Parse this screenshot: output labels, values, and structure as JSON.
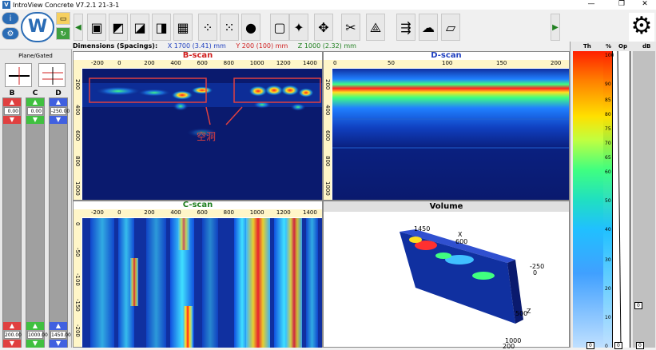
{
  "app": {
    "title": "IntroView Concrete V7.2.1   21-3-1",
    "icon": "V",
    "min": "—",
    "max": "❐",
    "close": "✕"
  },
  "toolbar": {
    "icons": [
      "cube-icon",
      "cube-red-icon",
      "cube-green-icon",
      "cube-blue-icon",
      "cube-multi-icon",
      "points-icon",
      "points-red-icon",
      "sphere-icon",
      "frame-icon",
      "puzzle-icon",
      "arrows-icon",
      "scissors-icon",
      "triangle-icon",
      "arrows-multi-icon",
      "blob-icon",
      "map-icon"
    ],
    "gear_glyph": "⚙",
    "left_arrow": "◀",
    "right_arrow": "▶"
  },
  "left": {
    "plane_label": "Plane/Gated",
    "cols": [
      {
        "label": "B",
        "top": "0.00",
        "bottom": "200.00",
        "color": "#e04040"
      },
      {
        "label": "C",
        "top": "0.00",
        "bottom": "1000.00",
        "color": "#40c040"
      },
      {
        "label": "D",
        "top": "-250.00",
        "bottom": "1450.00",
        "color": "#4060e0"
      }
    ]
  },
  "dimensions": {
    "label": "Dimensions (Spacings):",
    "x": "X  1700 (3.41) mm",
    "y": "Y  200 (100) mm",
    "z": "Z  1000 (2.32) mm"
  },
  "bscan": {
    "title": "B-scan",
    "xticks": [
      "-200",
      "0",
      "200",
      "400",
      "600",
      "800",
      "1000",
      "1200",
      "1400"
    ],
    "yticks": [
      "200",
      "400",
      "600",
      "800",
      "1000"
    ],
    "annotation": "空洞"
  },
  "dscan": {
    "title": "D-scan",
    "xticks": [
      "0",
      "50",
      "100",
      "150",
      "200"
    ],
    "yticks": [
      "200",
      "400",
      "600",
      "800",
      "1000"
    ]
  },
  "cscan": {
    "title": "C-scan",
    "xticks": [
      "-200",
      "0",
      "200",
      "400",
      "600",
      "800",
      "1000",
      "1200",
      "1400"
    ],
    "yticks": [
      "0",
      "-50",
      "-100",
      "-150",
      "-200"
    ]
  },
  "volume": {
    "title": "Volume",
    "labels": [
      "1450",
      "X",
      "600",
      "-250",
      "0",
      "500",
      "Z",
      "1000",
      "200"
    ]
  },
  "colorbar": {
    "headers": [
      "Th",
      "%",
      "Op",
      "dB"
    ],
    "nums": [
      "100",
      "90",
      "85",
      "80",
      "75",
      "70",
      "65",
      "60",
      "50",
      "40",
      "30",
      "20",
      "10",
      "0"
    ],
    "bottom_vals": [
      "0",
      "0",
      "0"
    ]
  },
  "colors": {
    "accent": "#1e3cb4",
    "title_red": "#d02020",
    "title_blue": "#2040c0",
    "title_green": "#208020"
  }
}
